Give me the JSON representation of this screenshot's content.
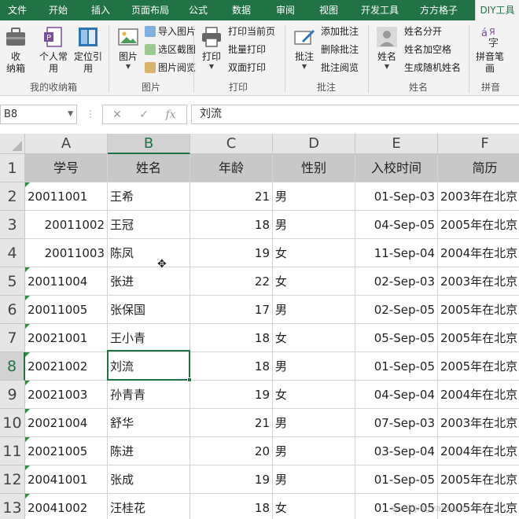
{
  "tabs": [
    "文件",
    "开始",
    "插入",
    "页面布局",
    "公式",
    "数据",
    "审阅",
    "视图",
    "开发工具",
    "方方格子",
    "DIY工具"
  ],
  "active_tab": "DIY工具",
  "ribbon": {
    "groups": {
      "my_box": {
        "label": "我的收纳箱",
        "collect": "收\n纳箱",
        "personal": "个人常\n用",
        "locate": "定位引\n用"
      },
      "image": {
        "label": "图片",
        "image_btn": "图片",
        "import_image": "导入图片",
        "screenshot": "选区截图",
        "image_view": "图片阅览"
      },
      "print": {
        "label": "打印",
        "print_btn": "打印",
        "print_current": "打印当前页",
        "batch_print": "批量打印",
        "duplex_print": "双面打印"
      },
      "comment": {
        "label": "批注",
        "comment_btn": "批注",
        "add_comment": "添加批注",
        "delete_comment": "删除批注",
        "view_comment": "批注阅览"
      },
      "name": {
        "label": "姓名",
        "name_btn": "姓名",
        "split_name": "姓名分开",
        "name_space": "姓名加空格",
        "random_name": "生成随机姓名"
      },
      "pinyin": {
        "label": "拼音",
        "pinyin_btn": "拼音笔\n画"
      }
    }
  },
  "formula_bar": {
    "name_box": "B8",
    "cancel": "✕",
    "confirm": "✓",
    "fx": "fx",
    "content": "刘流"
  },
  "columns": [
    "A",
    "B",
    "C",
    "D",
    "E",
    "F"
  ],
  "selected_column": "B",
  "selected_row": "8",
  "rows": [
    {
      "num": "1",
      "cells": [
        "学号",
        "姓名",
        "年龄",
        "性别",
        "入校时间",
        "简历"
      ]
    },
    {
      "num": "2",
      "cells": [
        "20011001",
        "王希",
        "21",
        "男",
        "01-Sep-03",
        "2003年在北京"
      ]
    },
    {
      "num": "3",
      "cells": [
        "20011002",
        "王冠",
        "18",
        "男",
        "04-Sep-05",
        "2005年在北京"
      ]
    },
    {
      "num": "4",
      "cells": [
        "20011003",
        "陈凤",
        "19",
        "女",
        "11-Sep-04",
        "2004年在北京"
      ]
    },
    {
      "num": "5",
      "cells": [
        "20011004",
        "张进",
        "22",
        "女",
        "02-Sep-03",
        "2003年在北京"
      ]
    },
    {
      "num": "6",
      "cells": [
        "20011005",
        "张保国",
        "17",
        "男",
        "02-Sep-05",
        "2005年在北京"
      ]
    },
    {
      "num": "7",
      "cells": [
        "20021001",
        "王小青",
        "18",
        "女",
        "05-Sep-05",
        "2005年在北京"
      ]
    },
    {
      "num": "8",
      "cells": [
        "20021002",
        "刘流",
        "18",
        "男",
        "01-Sep-05",
        "2005年在北京"
      ]
    },
    {
      "num": "9",
      "cells": [
        "20021003",
        "孙青青",
        "19",
        "女",
        "04-Sep-04",
        "2004年在北京"
      ]
    },
    {
      "num": "10",
      "cells": [
        "20021004",
        "舒华",
        "21",
        "男",
        "07-Sep-03",
        "2003年在北京"
      ]
    },
    {
      "num": "11",
      "cells": [
        "20021005",
        "陈进",
        "20",
        "男",
        "03-Sep-04",
        "2004年在北京"
      ]
    },
    {
      "num": "12",
      "cells": [
        "20041001",
        "张成",
        "19",
        "男",
        "01-Sep-05",
        "2005年在北京"
      ]
    },
    {
      "num": "13",
      "cells": [
        "20041002",
        "汪桂花",
        "18",
        "女",
        "01-Sep-05",
        "2005年在北京"
      ]
    }
  ],
  "watermark": "www.jingyanbaidu.com",
  "accent_color": "#217346"
}
